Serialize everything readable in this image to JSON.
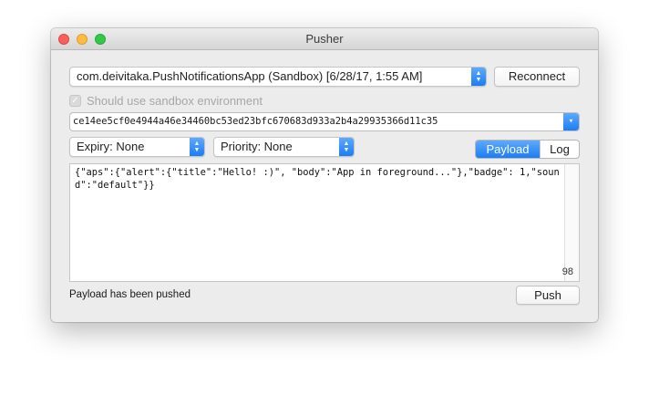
{
  "window": {
    "title": "Pusher"
  },
  "app_selector": {
    "value": "com.deivitaka.PushNotificationsApp (Sandbox)  [6/28/17, 1:55 AM]"
  },
  "reconnect_button": {
    "label": "Reconnect"
  },
  "sandbox_checkbox": {
    "label": "Should use sandbox environment",
    "checked": true,
    "enabled": false
  },
  "device_token": {
    "value": "ce14ee5cf0e4944a46e34460bc53ed23bfc670683d933a2b4a29935366d11c35"
  },
  "expiry_selector": {
    "value": "Expiry: None"
  },
  "priority_selector": {
    "value": "Priority: None"
  },
  "view_tabs": {
    "payload": "Payload",
    "log": "Log",
    "selected": "Payload"
  },
  "payload_editor": {
    "text": "{\"aps\":{\"alert\":{\"title\":\"Hello! :)\", \"body\":\"App in foreground...\"},\"badge\": 1,\"sound\":\"default\"}}",
    "character_count": "98"
  },
  "status_text": "Payload has been pushed",
  "push_button": {
    "label": "Push"
  },
  "colors": {
    "accent": "#1b7df4",
    "window_bg": "#ececec",
    "close": "#fc605c",
    "minimize": "#fdbc40",
    "maximize": "#34c84a"
  },
  "icons": [
    "close-icon",
    "minimize-icon",
    "zoom-icon",
    "stepper-icon",
    "chevron-down-icon",
    "checkmark-icon"
  ]
}
